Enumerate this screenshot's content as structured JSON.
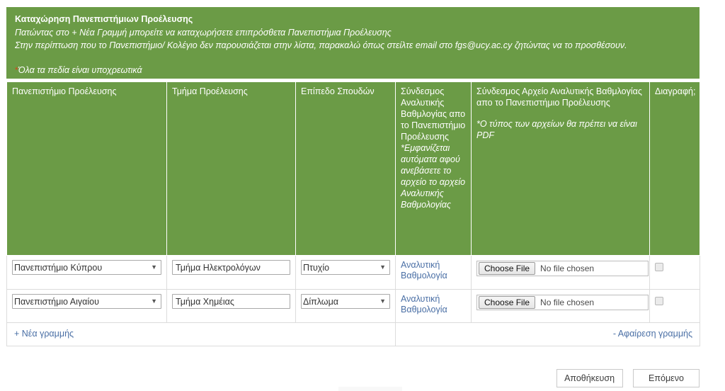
{
  "banner": {
    "title": "Καταχώρηση Πανεπιστήμιων Προέλευσης",
    "line1": "Πατώντας στο + Νέα Γραμμή μπορείτε να καταχωρήσετε επιπρόσθετα Πανεπιστήμια Προέλευσης",
    "line2": "Στην περίπτωση που το Πανεπιστήμιο/ Κολέγιο δεν παρουσιάζεται στην λίστα, παρακαλώ όπως στείλτε email στο fgs@ucy.ac.cy ζητώντας να το προσθέσουν.",
    "required_star": "*",
    "required_note": "Όλα τα πεδία είναι υποχρεωτικά",
    "background_color": "#6b9b46"
  },
  "table": {
    "headers": {
      "university": "Πανεπιστήμιο Προέλευσης",
      "department": "Τμήμα Προέλευσης",
      "level": "Επίπεδο Σπουδών",
      "transcript_link": "Σύνδεσμος Αναλυτικής Βαθμλογίας απο το Πανεπιστήμιο Προέλευσης",
      "transcript_link_note": "*Εμφανίζεται αυτόματα αφού ανεβάσετε το αρχείο το αρχείο Αναλυτικής Βαθμολογίας",
      "transcript_file": "Σύνδεσμος Αρχείο Αναλυτικής Βαθμλογίας απο το Πανεπιστήμιο Προέλευσης",
      "transcript_file_note": "*Ο τύπος των αρχείων θα πρέπει να είναι PDF",
      "delete": "Διαγραφή;"
    },
    "rows": [
      {
        "university": "Πανεπιστήμιο Κύπρου",
        "department": "Τμήμα Ηλεκτρολόγων",
        "level": "Πτυχίο",
        "transcript_link": "Αναλυτική Βαθμολογία",
        "file_button": "Choose File",
        "file_status": "No file chosen",
        "delete_checked": false
      },
      {
        "university": "Πανεπιστήμιο Αιγαίου",
        "department": "Τμήμα Χημέιας",
        "level": "Δίπλωμα",
        "transcript_link": "Αναλυτική Βαθμολογία",
        "file_button": "Choose File",
        "file_status": "No file chosen",
        "delete_checked": false
      }
    ],
    "footer": {
      "add_row": "+ Νέα γραμμής",
      "remove_row": "- Αφαίρεση γραμμής"
    },
    "link_color": "#4a6fa5"
  },
  "actions": {
    "save": "Αποθήκευση",
    "next": "Επόμενο"
  }
}
